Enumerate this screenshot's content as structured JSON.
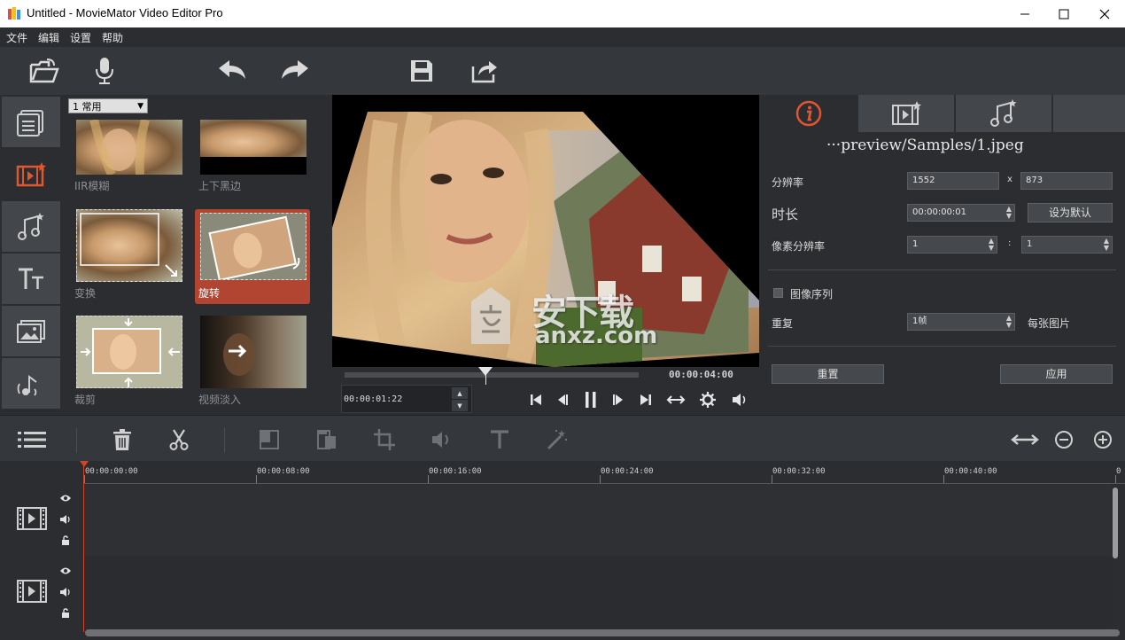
{
  "window": {
    "title": "Untitled - MovieMator Video Editor Pro",
    "controls": [
      "minimize-icon",
      "maximize-icon",
      "close-icon"
    ]
  },
  "menu": [
    "文件",
    "编辑",
    "设置",
    "帮助"
  ],
  "toolbar": [
    "open-folder-icon",
    "microphone-icon",
    "undo-icon",
    "redo-icon",
    "save-icon",
    "export-icon"
  ],
  "rail": [
    "media-library-icon",
    "video-filter-icon",
    "audio-filter-icon",
    "text-icon",
    "image-icon",
    "audio-effect-icon"
  ],
  "library": {
    "category_select": "1 常用",
    "effects": [
      {
        "label": "IIR模糊"
      },
      {
        "label": "上下黑边"
      },
      {
        "label": "变换"
      },
      {
        "label": "旋转",
        "selected": true
      },
      {
        "label": "裁剪"
      },
      {
        "label": "视频淡入"
      }
    ]
  },
  "player": {
    "duration": "00:00:04:00",
    "timecode": "00:00:01:22",
    "progress": 0.48,
    "controls": [
      "skip-to-start-icon",
      "step-back-icon",
      "pause-icon",
      "step-forward-icon",
      "skip-to-end-icon",
      "fit-icon",
      "settings-icon",
      "volume-icon"
    ]
  },
  "properties": {
    "tabs": [
      "info-icon",
      "video-filter-icon",
      "audio-filter-icon",
      "empty-tab"
    ],
    "path": "···preview/Samples/1.jpeg",
    "resolution_label": "分辨率",
    "resolution_w": "1552",
    "resolution_x": "x",
    "resolution_h": "873",
    "duration_label": "时长",
    "duration_value": "00:00:00:01",
    "set_default_button": "设为默认",
    "pixel_aspect_label": "像素分辨率",
    "pixel_aspect_w": "1",
    "pixel_aspect_sep": ":",
    "pixel_aspect_h": "1",
    "image_sequence_label": "图像序列",
    "image_sequence_checked": false,
    "repeat_label": "重复",
    "repeat_value": "1帧",
    "repeat_unit": "每张图片",
    "reset_button": "重置",
    "apply_button": "应用"
  },
  "timeline": {
    "toolbar_left": [
      "menu-list-icon",
      "delete-icon",
      "cut-icon",
      "split-icon",
      "copy-icon",
      "crop-icon",
      "audio-icon",
      "text-tool-icon",
      "magic-wand-icon"
    ],
    "toolbar_right": [
      "fit-timeline-icon",
      "zoom-out-icon",
      "zoom-in-icon"
    ],
    "ruler": [
      "00:00:00:00",
      "00:00:08:00",
      "00:00:16:00",
      "00:00:24:00",
      "00:00:32:00",
      "00:00:40:00",
      "0"
    ],
    "tracks": [
      {
        "type": "video",
        "icons": [
          "film-icon",
          "eye-icon",
          "speaker-icon",
          "lock-icon"
        ]
      },
      {
        "type": "video",
        "icons": [
          "film-icon",
          "eye-icon",
          "speaker-icon",
          "lock-icon"
        ]
      }
    ]
  },
  "watermark": {
    "brand": "安下载",
    "domain": "anxz.com"
  },
  "colors": {
    "accent": "#b24532",
    "background": "#2b2d30",
    "panel": "#34373b",
    "playhead": "#d2432a"
  }
}
